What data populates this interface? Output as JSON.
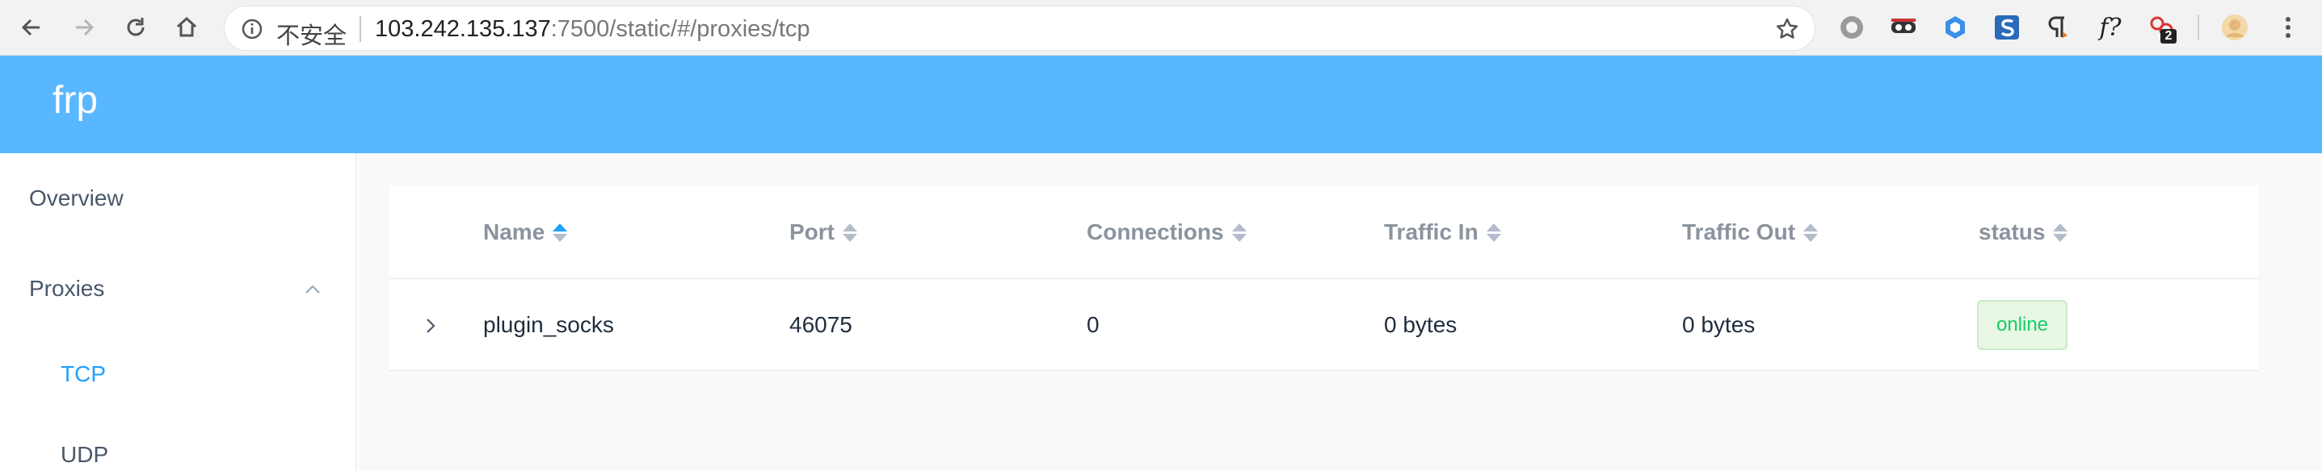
{
  "browser": {
    "security_label": "不安全",
    "url_host": "103.242.135.137",
    "url_rest": ":7500/static/#/proxies/tcp",
    "extension_badge": "2",
    "icons": [
      "back-icon",
      "forward-icon",
      "reload-icon",
      "home-icon",
      "info-icon",
      "star-icon",
      "circle-extension-icon",
      "mask-extension-icon",
      "cube-extension-icon",
      "s-extension-icon",
      "pilcrow-extension-icon",
      "f-question-extension-icon",
      "network-extension-icon",
      "profile-avatar-icon",
      "menu-dots-icon"
    ],
    "ext_f_label": "f?"
  },
  "app": {
    "brand": "frp"
  },
  "sidebar": {
    "overview": "Overview",
    "proxies": "Proxies",
    "tcp": "TCP",
    "udp": "UDP"
  },
  "table": {
    "columns": [
      "Name",
      "Port",
      "Connections",
      "Traffic In",
      "Traffic Out",
      "status"
    ],
    "rows": [
      {
        "name": "plugin_socks",
        "port": "46075",
        "connections": "0",
        "traffic_in": "0 bytes",
        "traffic_out": "0 bytes",
        "status": "online"
      }
    ]
  },
  "colors": {
    "header_bg": "#58b7ff",
    "active_link": "#20a0ff",
    "online_tag": "#13ce66"
  }
}
